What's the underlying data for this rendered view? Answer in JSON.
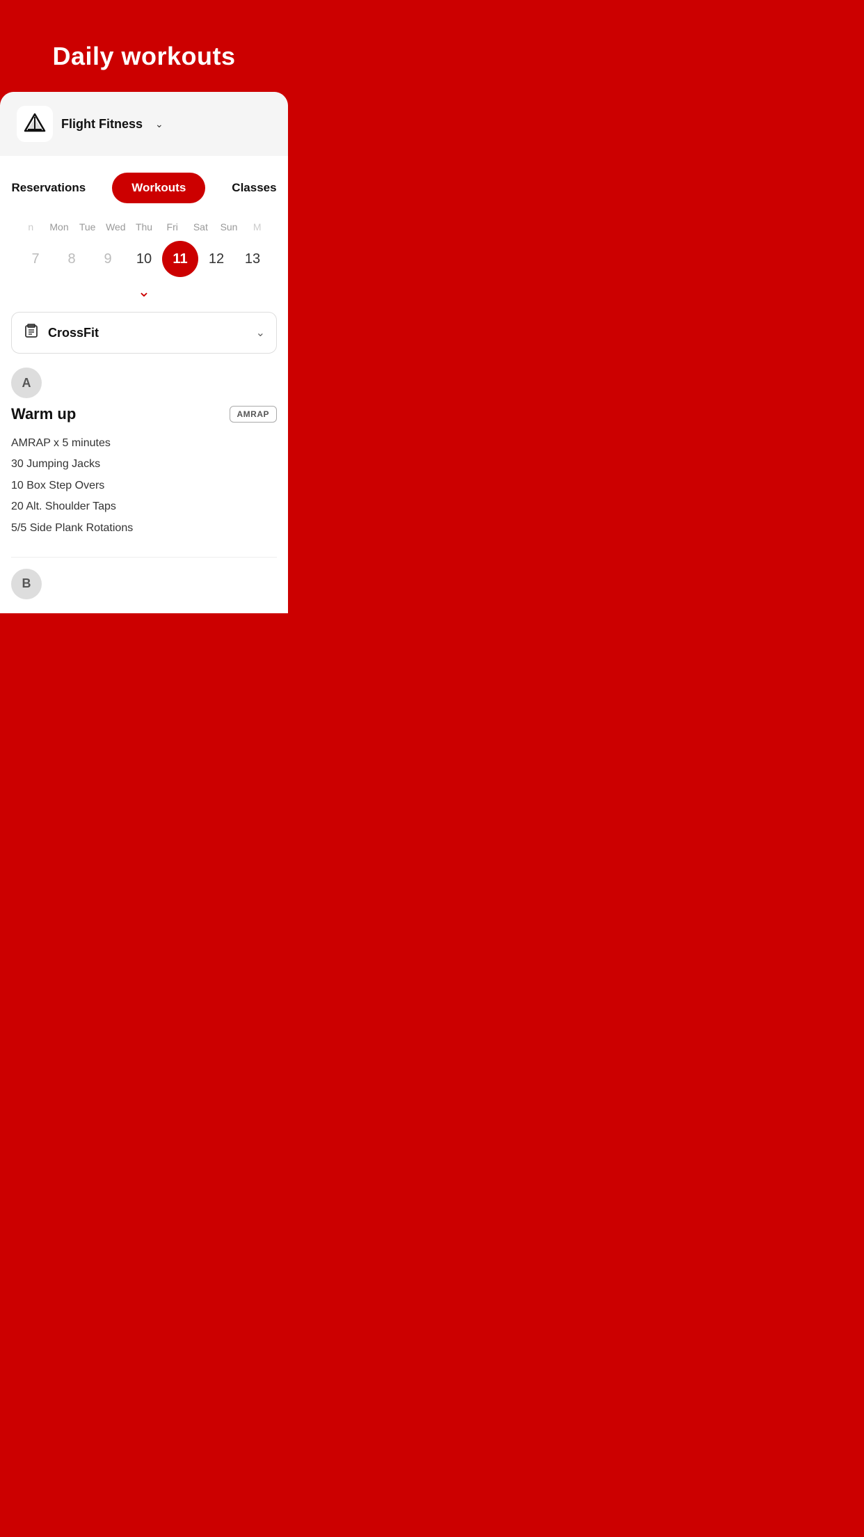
{
  "header": {
    "title": "Daily  workouts",
    "background": "#CC0000"
  },
  "gym": {
    "name": "Flight Fitness",
    "dropdown_label": "chevron-down"
  },
  "tabs": [
    {
      "id": "reservations",
      "label": "Reservations",
      "active": false
    },
    {
      "id": "workouts",
      "label": "Workouts",
      "active": true
    },
    {
      "id": "classes",
      "label": "Classes",
      "active": false
    }
  ],
  "calendar": {
    "days": [
      {
        "label": "n",
        "partial": true
      },
      {
        "label": "Mon",
        "partial": false
      },
      {
        "label": "Tue",
        "partial": false
      },
      {
        "label": "Wed",
        "partial": false
      },
      {
        "label": "Thu",
        "partial": false
      },
      {
        "label": "Fri",
        "partial": false
      },
      {
        "label": "Sat",
        "partial": false
      },
      {
        "label": "Sun",
        "partial": false
      },
      {
        "label": "M",
        "partial": true
      }
    ],
    "dates": [
      {
        "num": "7",
        "state": "dim"
      },
      {
        "num": "8",
        "state": "dim"
      },
      {
        "num": "9",
        "state": "dim"
      },
      {
        "num": "10",
        "state": "normal"
      },
      {
        "num": "11",
        "state": "active"
      },
      {
        "num": "12",
        "state": "normal"
      },
      {
        "num": "13",
        "state": "normal"
      }
    ]
  },
  "workout_type": {
    "name": "CrossFit",
    "icon": "clipboard"
  },
  "sections": [
    {
      "avatar_label": "A",
      "title": "Warm up",
      "badge": "AMRAP",
      "lines": [
        "AMRAP x 5 minutes",
        "30 Jumping Jacks",
        "10 Box Step Overs",
        "20 Alt. Shoulder Taps",
        "5/5 Side Plank Rotations"
      ]
    },
    {
      "avatar_label": "B"
    }
  ]
}
